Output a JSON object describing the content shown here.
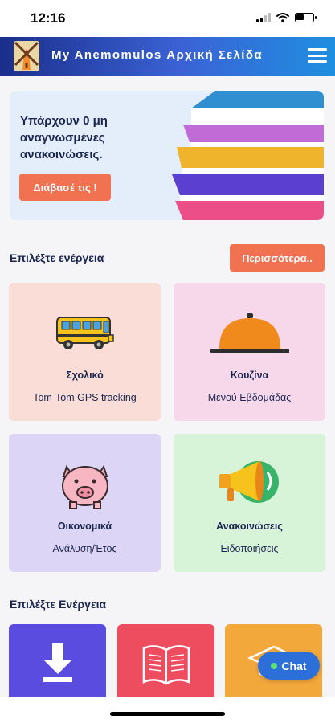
{
  "status": {
    "time": "12:16"
  },
  "header": {
    "title": "My Anemomulos Αρχική Σελίδα",
    "logo_icon": "windmill-logo-icon",
    "menu_icon": "hamburger-menu-icon"
  },
  "banner": {
    "line1": "Υπάρχουν 0 μη",
    "line2": "αναγνωσμένες",
    "line3": "ανακοινώσεις.",
    "button": "Διάβασέ τις !"
  },
  "actions": {
    "title": "Επιλέξτε ενέργεια",
    "more": "Περισσότερα.."
  },
  "cards": [
    {
      "title": "Σχολικό",
      "subtitle": "Tom-Tom GPS tracking",
      "icon": "school-bus-icon",
      "color": "#f9ddd6"
    },
    {
      "title": "Κουζίνα",
      "subtitle": "Μενού Εβδομάδας",
      "icon": "food-cloche-icon",
      "color": "#f6d8ea"
    },
    {
      "title": "Οικονομικά",
      "subtitle": "Ανάλυση/Έτος",
      "icon": "piggy-bank-icon",
      "color": "#ddd5f6"
    },
    {
      "title": "Ανακοινώσεις",
      "subtitle": "Ειδοποιήσεις",
      "icon": "megaphone-icon",
      "color": "#d7f3d8"
    }
  ],
  "actions2": {
    "title": "Επιλέξτε Ενέργεια"
  },
  "tiles": [
    {
      "icon": "download-icon",
      "color": "#5b4ce0"
    },
    {
      "icon": "open-book-icon",
      "color": "#ee4d60"
    },
    {
      "icon": "graduation-cap-icon",
      "color": "#f3a83c"
    }
  ],
  "chat": {
    "label": "Chat"
  }
}
